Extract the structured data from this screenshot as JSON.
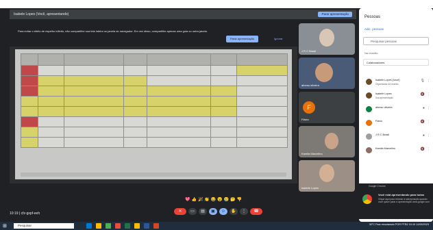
{
  "stage": {
    "presenter_title": "Isabele Lopes (Você, apresentando)",
    "stop_presenting": "Parar apresentação"
  },
  "banner": {
    "message": "Para evitar o efeito de espelho infinito, não compartilhe sua tela inteira ou janela do navegador. Em vez disso, compartilhe apenas uma guia ou outra janela.",
    "stop_label": "Parar apresentação",
    "ignore_label": "Ignorar"
  },
  "tiles": [
    {
      "name": "J R C Brasil"
    },
    {
      "name": "afonso oliveira"
    },
    {
      "name": "Flávio",
      "initial": "F"
    },
    {
      "name": "Kamila Marcelino"
    },
    {
      "name": "Isabele Lopes"
    }
  ],
  "bottom": {
    "meeting_info": "10:19 | cfz-gxpf-eeh",
    "reactions": "💖👍🎉👏😂😮😢🤔👎"
  },
  "panel": {
    "title": "Pessoas",
    "add_people": "Adic. pessoas",
    "search_placeholder": "Pesquisar pessoas",
    "section": "Na reunião",
    "group": "Colaboradores",
    "people": [
      {
        "name": "Isabele Lopes (Você)",
        "status": "Organizador da reunião",
        "color": "#6b4a2b"
      },
      {
        "name": "Isabele Lopes",
        "status": "Sua apresentação",
        "color": "#6b4a2b"
      },
      {
        "name": "afonso oliveira",
        "status": "",
        "color": "#0b8043"
      },
      {
        "name": "Flávio",
        "status": "",
        "color": "#e8710a"
      },
      {
        "name": "J R C Brasil",
        "status": "",
        "color": "#9e9e9e"
      },
      {
        "name": "Kamila Marcelino",
        "status": "",
        "color": "#8d6e63"
      }
    ]
  },
  "notice": {
    "header": "Google Chrome",
    "title": "Você está apresentando para todos",
    "detail": "Clique aqui para retomar à sobreposição quando você quiser parar a apresentação www.google.com"
  },
  "taskbar": {
    "search_placeholder": "Pesquisar",
    "weather": "30°C Parc ensolarado",
    "lang": "POR PTB2",
    "time": "10:19",
    "date": "11/05/2023"
  }
}
